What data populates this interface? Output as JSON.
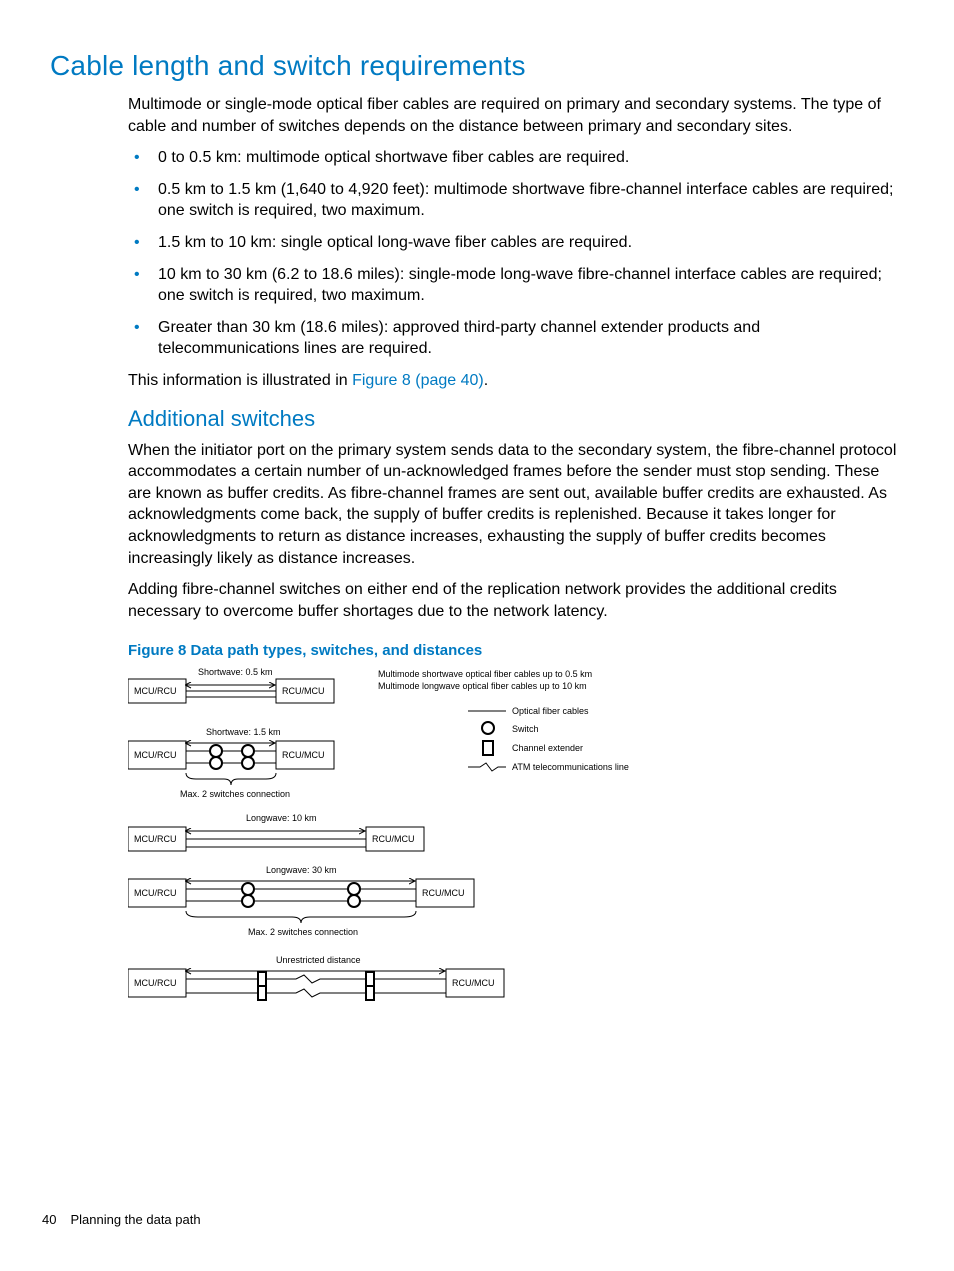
{
  "h1": "Cable length and switch requirements",
  "intro": "Multimode or single-mode optical fiber cables are required on primary and secondary systems. The type of cable and number of switches depends on the distance between primary and secondary sites.",
  "bullets": [
    "0 to 0.5 km: multimode optical shortwave fiber cables are required.",
    "0.5 km to 1.5 km (1,640 to 4,920 feet): multimode shortwave fibre-channel interface cables are required; one switch is required, two maximum.",
    "1.5 km to 10 km: single optical long-wave fiber cables are required.",
    "10 km to 30 km (6.2 to 18.6 miles): single-mode long-wave fibre-channel interface cables are required; one switch is required, two maximum.",
    "Greater than 30 km (18.6 miles): approved third-party channel extender products and telecommunications lines are required."
  ],
  "illus_prefix": "This information is illustrated in ",
  "illus_link": "Figure 8 (page 40)",
  "illus_suffix": ".",
  "h2": "Additional switches",
  "p2a": "When the initiator port on the primary system sends data to the secondary system, the fibre-channel protocol accommodates a certain number of un-acknowledged frames before the sender must stop sending. These are known as buffer credits. As fibre-channel frames are sent out, available buffer credits are exhausted. As acknowledgments come back, the supply of buffer credits is replenished. Because it takes longer for acknowledgments to return as distance increases, exhausting the supply of buffer credits becomes increasingly likely as distance increases.",
  "p2b": "Adding fibre-channel switches on either end of the replication network provides the additional credits necessary to overcome buffer shortages due to the network latency.",
  "figcaption": "Figure 8 Data path types, switches, and distances",
  "diagram": {
    "node_left": "MCU/RCU",
    "node_right": "RCU/MCU",
    "row1_label": "Shortwave: 0.5 km",
    "row2_label": "Shortwave: 1.5 km",
    "row2_caption": "Max. 2 switches connection",
    "row3_label": "Longwave: 10 km",
    "row4_label": "Longwave: 30 km",
    "row4_caption": "Max. 2 switches connection",
    "row5_label": "Unrestricted distance",
    "legend_line1": "Multimode shortwave optical fiber cables up to 0.5 km",
    "legend_line2": "Multimode longwave optical fiber cables up to 10 km",
    "legend_cable": "Optical fiber cables",
    "legend_switch": "Switch",
    "legend_extender": "Channel extender",
    "legend_atm": "ATM telecommunications line"
  },
  "footer_page": "40",
  "footer_text": "Planning the data path"
}
